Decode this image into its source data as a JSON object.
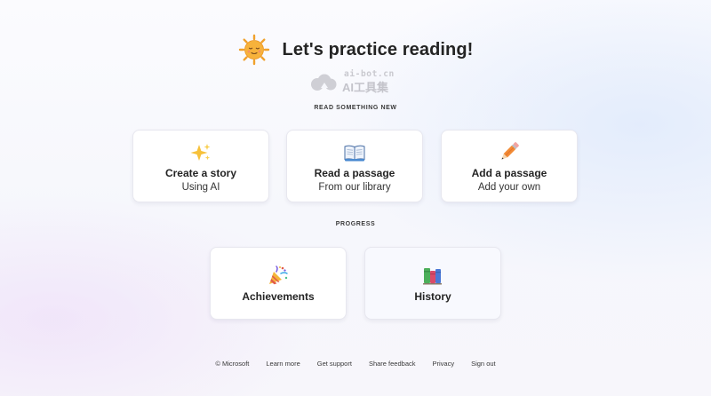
{
  "header": {
    "title": "Let's practice reading!",
    "icon": "sun-face-icon"
  },
  "watermark": {
    "top": "ai-bot.cn",
    "main": "AI工具集"
  },
  "sections": {
    "read_new": "READ SOMETHING NEW",
    "progress": "PROGRESS"
  },
  "read_cards": [
    {
      "icon": "sparkles-icon",
      "title": "Create a story",
      "subtitle": "Using AI"
    },
    {
      "icon": "open-book-icon",
      "title": "Read a passage",
      "subtitle": "From our library"
    },
    {
      "icon": "pencil-icon",
      "title": "Add a passage",
      "subtitle": "Add your own"
    }
  ],
  "progress_cards": [
    {
      "icon": "party-popper-icon",
      "title": "Achievements"
    },
    {
      "icon": "books-icon",
      "title": "History"
    }
  ],
  "footer": {
    "copyright": "© Microsoft",
    "links": [
      "Learn more",
      "Get support",
      "Share feedback",
      "Privacy",
      "Sign out"
    ]
  },
  "colors": {
    "text": "#242424",
    "card_border": "#e7e7ef",
    "sun": "#f5a623"
  }
}
